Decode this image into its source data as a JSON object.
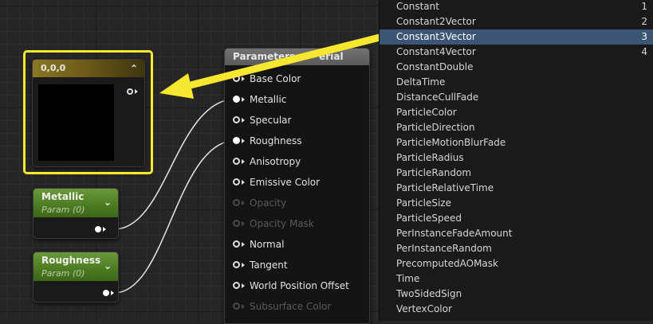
{
  "constant_node": {
    "title": "0,0,0",
    "collapse_icon": "chevron-up-icon"
  },
  "param_nodes": [
    {
      "title": "Metallic",
      "subtitle": "Param (0)"
    },
    {
      "title": "Roughness",
      "subtitle": "Param (0)"
    }
  ],
  "material_node": {
    "title": "Parameters",
    "title_suffix": "erial",
    "inputs": [
      {
        "label": "Base Color",
        "enabled": true,
        "connected": false
      },
      {
        "label": "Metallic",
        "enabled": true,
        "connected": true
      },
      {
        "label": "Specular",
        "enabled": true,
        "connected": false
      },
      {
        "label": "Roughness",
        "enabled": true,
        "connected": true
      },
      {
        "label": "Anisotropy",
        "enabled": true,
        "connected": false
      },
      {
        "label": "Emissive Color",
        "enabled": true,
        "connected": false
      },
      {
        "label": "Opacity",
        "enabled": false,
        "connected": false
      },
      {
        "label": "Opacity Mask",
        "enabled": false,
        "connected": false
      },
      {
        "label": "Normal",
        "enabled": true,
        "connected": false
      },
      {
        "label": "Tangent",
        "enabled": true,
        "connected": false
      },
      {
        "label": "World Position Offset",
        "enabled": true,
        "connected": false
      },
      {
        "label": "Subsurface Color",
        "enabled": false,
        "connected": false
      }
    ]
  },
  "node_list": {
    "selected": "Constant3Vector",
    "items": [
      {
        "label": "Constant",
        "num": "1"
      },
      {
        "label": "Constant2Vector",
        "num": "2"
      },
      {
        "label": "Constant3Vector",
        "num": "3"
      },
      {
        "label": "Constant4Vector",
        "num": "4"
      },
      {
        "label": "ConstantDouble",
        "num": ""
      },
      {
        "label": "DeltaTime",
        "num": ""
      },
      {
        "label": "DistanceCullFade",
        "num": ""
      },
      {
        "label": "ParticleColor",
        "num": ""
      },
      {
        "label": "ParticleDirection",
        "num": ""
      },
      {
        "label": "ParticleMotionBlurFade",
        "num": ""
      },
      {
        "label": "ParticleRadius",
        "num": ""
      },
      {
        "label": "ParticleRandom",
        "num": ""
      },
      {
        "label": "ParticleRelativeTime",
        "num": ""
      },
      {
        "label": "ParticleSize",
        "num": ""
      },
      {
        "label": "ParticleSpeed",
        "num": ""
      },
      {
        "label": "PerInstanceFadeAmount",
        "num": ""
      },
      {
        "label": "PerInstanceRandom",
        "num": ""
      },
      {
        "label": "PrecomputedAOMask",
        "num": ""
      },
      {
        "label": "Time",
        "num": ""
      },
      {
        "label": "TwoSidedSign",
        "num": ""
      },
      {
        "label": "VertexColor",
        "num": ""
      }
    ]
  },
  "colors": {
    "highlight": "#f6e731",
    "arrow": "#f6e731",
    "selection": "#3b5574",
    "param_header": "#5a8a2c",
    "constant_header": "#8a7624"
  }
}
